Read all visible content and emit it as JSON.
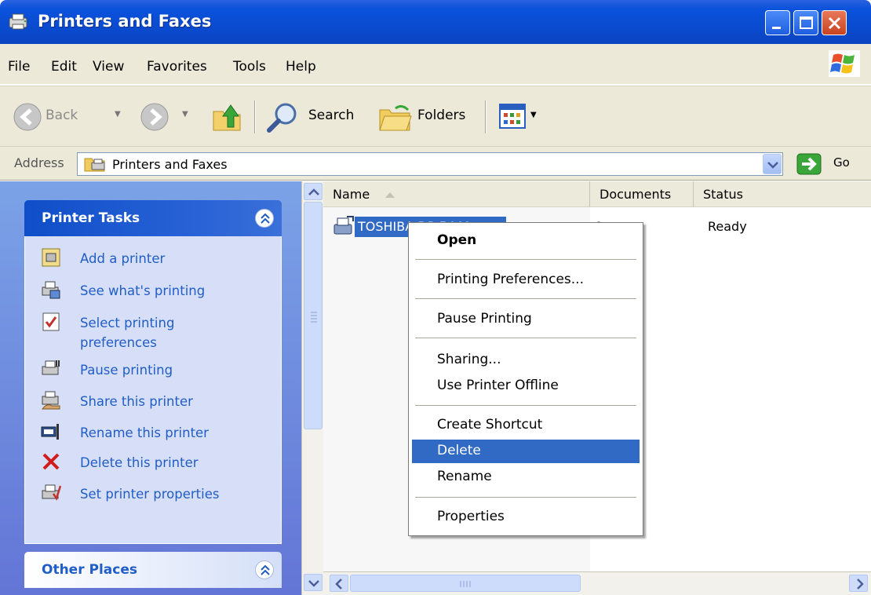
{
  "window": {
    "title": "Printers and Faxes"
  },
  "menu": {
    "items": [
      "File",
      "Edit",
      "View",
      "Favorites",
      "Tools",
      "Help"
    ]
  },
  "toolbar": {
    "back_label": "Back",
    "search_label": "Search",
    "folders_label": "Folders"
  },
  "address": {
    "label": "Address",
    "value": "Printers and Faxes",
    "go_label": "Go"
  },
  "task_pane": {
    "printer_tasks": {
      "title": "Printer Tasks",
      "items": [
        {
          "label": "Add a printer",
          "icon": "add-printer-icon"
        },
        {
          "label": "See what's printing",
          "icon": "print-queue-icon"
        },
        {
          "label": "Select printing",
          "label2": "preferences",
          "icon": "preferences-icon"
        },
        {
          "label": "Pause printing",
          "icon": "pause-printer-icon"
        },
        {
          "label": "Share this printer",
          "icon": "share-printer-icon"
        },
        {
          "label": "Rename this printer",
          "icon": "rename-printer-icon"
        },
        {
          "label": "Delete this printer",
          "icon": "delete-icon"
        },
        {
          "label": "Set printer properties",
          "icon": "printer-properties-icon"
        }
      ]
    },
    "other_places": {
      "title": "Other Places"
    }
  },
  "list": {
    "columns": [
      "Name",
      "Documents",
      "Status"
    ],
    "rows": [
      {
        "name": "TOSHIBA DP-5440",
        "documents": "0",
        "status": "Ready"
      }
    ]
  },
  "context_menu": {
    "items": [
      "Open",
      "Printing Preferences...",
      "Pause Printing",
      "Sharing...",
      "Use Printer Offline",
      "Create Shortcut",
      "Delete",
      "Rename",
      "Properties"
    ],
    "selected": "Delete"
  },
  "colors": {
    "title_bar": "#0a4bd0",
    "selection": "#316ac5",
    "task_link": "#215dc6",
    "chrome": "#ece9d8"
  }
}
